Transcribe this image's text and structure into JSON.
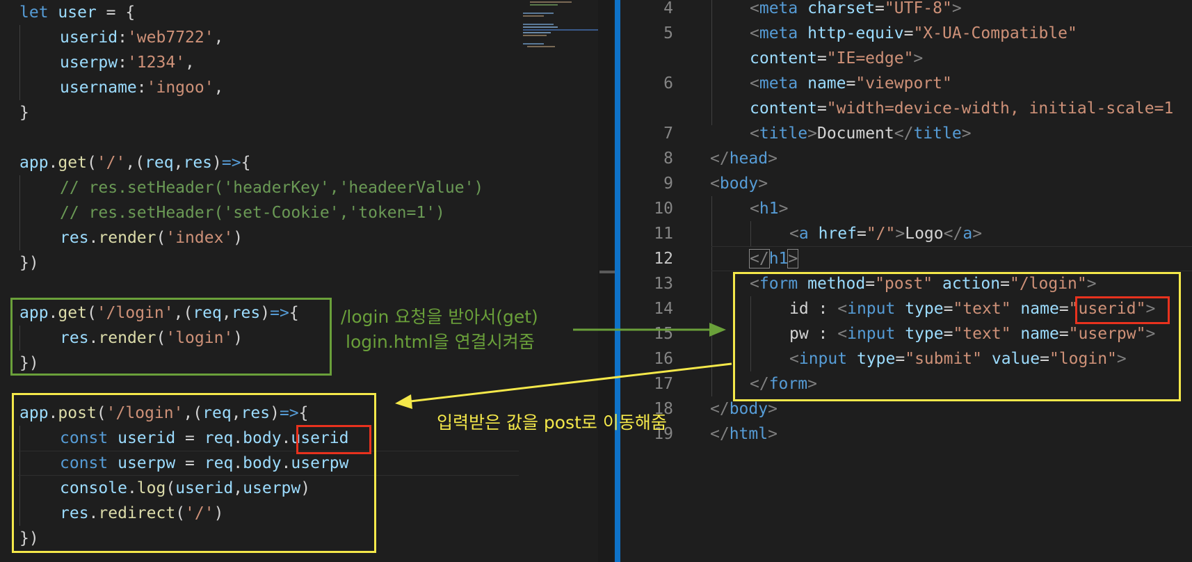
{
  "left_editor": {
    "lines": [
      [
        "let",
        " ",
        "user",
        " = {"
      ],
      [
        "userid",
        ":",
        "'web7722'",
        ","
      ],
      [
        "userpw",
        ":",
        "'1234'",
        ","
      ],
      [
        "username",
        ":",
        "'ingoo'",
        ","
      ],
      [
        "}"
      ],
      [],
      [
        "app",
        ".",
        "get",
        "(",
        "'/'",
        ",(",
        "req",
        ",",
        "res",
        ")",
        "=>",
        "{"
      ],
      [
        "// res.setHeader('headerKey','headeerValue')"
      ],
      [
        "// res.setHeader('set-Cookie','token=1')"
      ],
      [
        "res",
        ".",
        "render",
        "(",
        "'index'",
        ")"
      ],
      [
        "})"
      ],
      [],
      [
        "app",
        ".",
        "get",
        "(",
        "'/login'",
        ",(",
        "req",
        ",",
        "res",
        ")",
        "=>",
        "{"
      ],
      [
        "res",
        ".",
        "render",
        "(",
        "'login'",
        ")"
      ],
      [
        "})"
      ],
      [],
      [
        "app",
        ".",
        "post",
        "(",
        "'/login'",
        ",(",
        "req",
        ",",
        "res",
        ")",
        "=>",
        "{"
      ],
      [
        "const",
        " ",
        "userid",
        " = ",
        "req",
        ".",
        "body",
        ".",
        "userid"
      ],
      [
        "const",
        " ",
        "userpw",
        " = ",
        "req",
        ".",
        "body",
        ".",
        "userpw"
      ],
      [
        "console",
        ".",
        "log",
        "(",
        "userid",
        ",",
        "userpw",
        ")"
      ],
      [
        "res",
        ".",
        "redirect",
        "(",
        "'/'",
        ")"
      ],
      [
        "})"
      ]
    ]
  },
  "right_editor": {
    "line_numbers": [
      "4",
      "5",
      "",
      "6",
      "",
      "7",
      "8",
      "9",
      "10",
      "11",
      "12",
      "13",
      "14",
      "15",
      "16",
      "17",
      "18",
      "19"
    ],
    "active_line": "12",
    "lines": [
      [
        "<",
        "meta",
        " ",
        "charset",
        "=",
        "\"UTF-8\"",
        ">"
      ],
      [
        "<",
        "meta",
        " ",
        "http-equiv",
        "=",
        "\"X-UA-Compatible\""
      ],
      [
        "content",
        "=",
        "\"IE=edge\"",
        ">"
      ],
      [
        "<",
        "meta",
        " ",
        "name",
        "=",
        "\"viewport\""
      ],
      [
        "content",
        "=",
        "\"width=device-width, initial-scale=1"
      ],
      [
        "<",
        "title",
        ">",
        "Document",
        "</",
        "title",
        ">"
      ],
      [
        "</",
        "head",
        ">"
      ],
      [
        "<",
        "body",
        ">"
      ],
      [
        "<",
        "h1",
        ">"
      ],
      [
        "<",
        "a",
        " ",
        "href",
        "=",
        "\"/\"",
        ">",
        "Logo",
        "</",
        "a",
        ">"
      ],
      [
        "</",
        "h1",
        ">"
      ],
      [
        "<",
        "form",
        " ",
        "method",
        "=",
        "\"post\"",
        " ",
        "action",
        "=",
        "\"/login\"",
        ">"
      ],
      [
        "id : ",
        "<",
        "input",
        " ",
        "type",
        "=",
        "\"text\"",
        " ",
        "name",
        "=",
        "\"userid\"",
        ">"
      ],
      [
        "pw : ",
        "<",
        "input",
        " ",
        "type",
        "=",
        "\"text\"",
        " ",
        "name",
        "=",
        "\"userpw\"",
        ">"
      ],
      [
        "<",
        "input",
        " ",
        "type",
        "=",
        "\"submit\"",
        " ",
        "value",
        "=",
        "\"login\"",
        ">"
      ],
      [
        "</",
        "form",
        ">"
      ],
      [
        "</",
        "body",
        ">"
      ],
      [
        "</",
        "html",
        ">"
      ]
    ]
  },
  "annotations": {
    "get_note_line1": "/login 요청을 받아서(get)",
    "get_note_line2": "login.html을 연결시켜줌",
    "post_note": "입력받은 값을 post로 이동해줌",
    "colors": {
      "green": "#6aa03a",
      "yellow": "#f4e84a",
      "red": "#e8321e"
    }
  }
}
